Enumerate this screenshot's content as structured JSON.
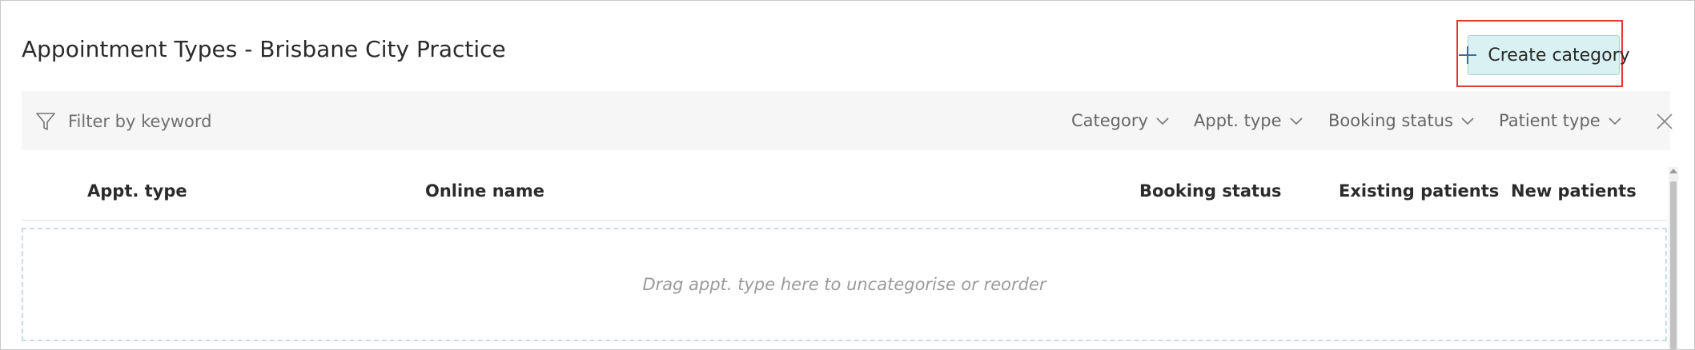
{
  "page": {
    "title": "Appointment Types - Brisbane City Practice",
    "create_button_label": "Create category"
  },
  "filter_bar": {
    "search_placeholder": "Filter by keyword",
    "dropdowns": [
      "Category",
      "Appt. type",
      "Booking status",
      "Patient type"
    ]
  },
  "table": {
    "columns": [
      "Appt. type",
      "Online name",
      "Booking status",
      "Existing patients",
      "New patients"
    ],
    "drop_zone_text": "Drag appt. type here to uncategorise or reorder"
  },
  "icons": {
    "create": "plus-icon",
    "filter": "funnel-icon",
    "dropdown": "chevron-down-icon",
    "clear": "close-icon"
  },
  "colors": {
    "accent_button_bg": "#d9f1f1",
    "highlight_border": "#e53935",
    "filter_bar_bg": "#f6f6f6"
  }
}
